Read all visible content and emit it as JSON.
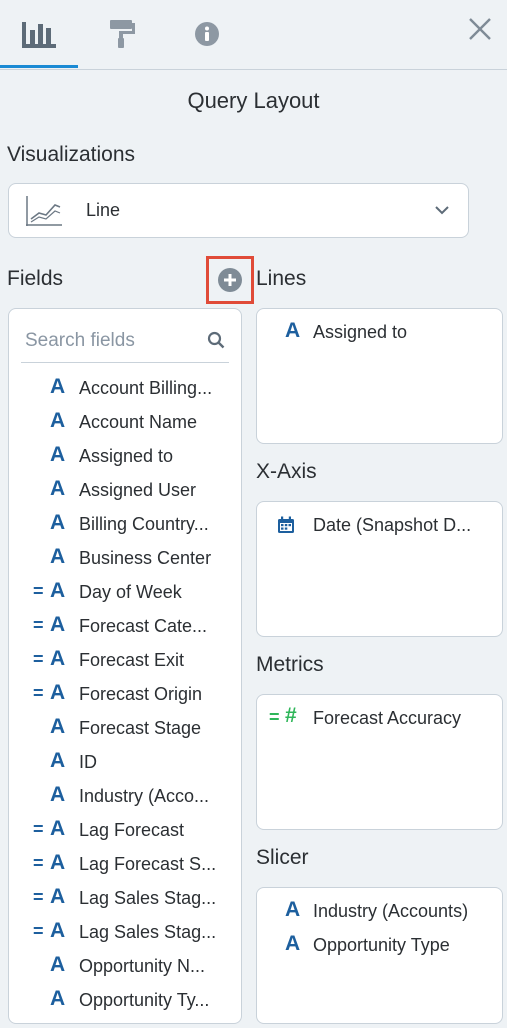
{
  "tabs": [
    {
      "icon": "bar-chart-icon",
      "active": true
    },
    {
      "icon": "paint-roller-icon",
      "active": false
    },
    {
      "icon": "info-icon",
      "active": false
    }
  ],
  "header": {
    "title": "Query Layout"
  },
  "visualizations": {
    "label": "Visualizations",
    "selected": "Line",
    "icon": "line-chart-icon"
  },
  "fields": {
    "label": "Fields",
    "search_placeholder": "Search fields",
    "items": [
      {
        "label": "Account Billing...",
        "calculated": false
      },
      {
        "label": "Account Name",
        "calculated": false
      },
      {
        "label": "Assigned to",
        "calculated": false
      },
      {
        "label": "Assigned User",
        "calculated": false
      },
      {
        "label": "Billing Country...",
        "calculated": false
      },
      {
        "label": "Business Center",
        "calculated": false
      },
      {
        "label": "Day of Week",
        "calculated": true
      },
      {
        "label": "Forecast Cate...",
        "calculated": true
      },
      {
        "label": "Forecast Exit",
        "calculated": true
      },
      {
        "label": "Forecast Origin",
        "calculated": true
      },
      {
        "label": "Forecast Stage",
        "calculated": false
      },
      {
        "label": "ID",
        "calculated": false
      },
      {
        "label": "Industry (Acco...",
        "calculated": false
      },
      {
        "label": "Lag Forecast",
        "calculated": true
      },
      {
        "label": "Lag Forecast S...",
        "calculated": true
      },
      {
        "label": "Lag Sales Stag...",
        "calculated": true
      },
      {
        "label": "Lag Sales Stag...",
        "calculated": true
      },
      {
        "label": "Opportunity N...",
        "calculated": false
      },
      {
        "label": "Opportunity Ty...",
        "calculated": false
      }
    ],
    "type_glyph": "A",
    "calc_glyph": "="
  },
  "zones": {
    "lines": {
      "label": "Lines",
      "items": [
        "Assigned to"
      ]
    },
    "x_axis": {
      "label": "X-Axis",
      "items": [
        "Date (Snapshot D..."
      ]
    },
    "metrics": {
      "label": "Metrics",
      "items": [
        "Forecast Accuracy"
      ],
      "glyph_calc": "=",
      "glyph_num": "#"
    },
    "slicer": {
      "label": "Slicer",
      "items": [
        "Industry (Accounts)",
        "Opportunity Type"
      ]
    }
  },
  "colors": {
    "accent": "#1a8ad4",
    "field_type": "#1d5f9e",
    "metric_green": "#2fb65a",
    "highlight_box": "#e04b38",
    "background": "#eef2f5"
  }
}
